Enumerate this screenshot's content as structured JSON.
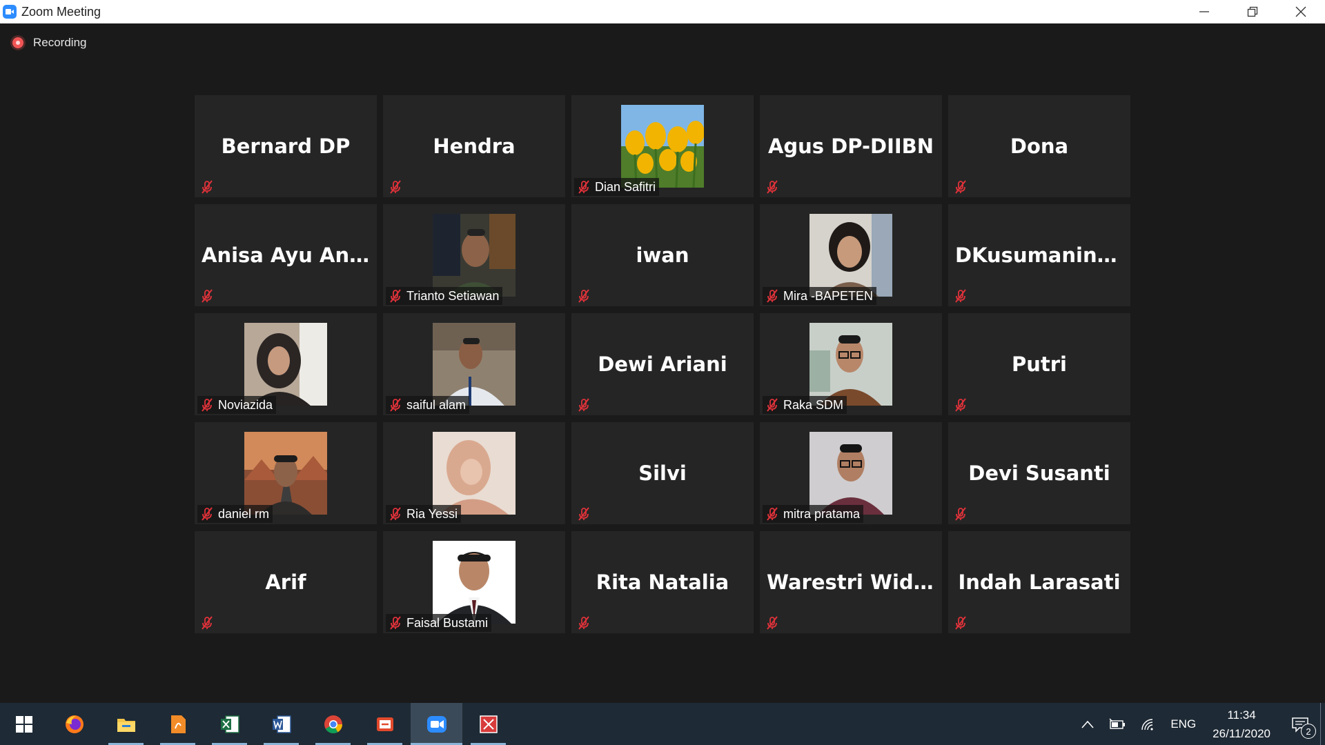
{
  "window": {
    "title": "Zoom Meeting"
  },
  "recording": {
    "label": "Recording"
  },
  "participants": [
    {
      "name": "Bernard DP",
      "video": false
    },
    {
      "name": "Hendra",
      "video": false
    },
    {
      "name": "Dian Safitri",
      "video": true,
      "photo": "tulip-flowers"
    },
    {
      "name": "Agus DP-DIIBN",
      "video": false
    },
    {
      "name": "Dona",
      "video": false
    },
    {
      "name": "Anisa Ayu Anin...",
      "video": false
    },
    {
      "name": "Trianto Setiawan",
      "video": true,
      "photo": "man-office"
    },
    {
      "name": "iwan",
      "video": false
    },
    {
      "name": "Mira -BAPETEN",
      "video": true,
      "photo": "woman-smile"
    },
    {
      "name": "DKusumaningt...",
      "video": false
    },
    {
      "name": "Noviazida",
      "video": true,
      "photo": "woman-hijab-dark"
    },
    {
      "name": "saiful alam",
      "video": true,
      "photo": "man-white-shirt"
    },
    {
      "name": "Dewi Ariani",
      "video": false
    },
    {
      "name": "Raka SDM",
      "video": true,
      "photo": "man-glasses-batik"
    },
    {
      "name": "Putri",
      "video": false
    },
    {
      "name": "daniel rm",
      "video": true,
      "photo": "man-desert-road"
    },
    {
      "name": "Ria Yessi",
      "video": true,
      "photo": "woman-hijab-pink"
    },
    {
      "name": "Silvi",
      "video": false
    },
    {
      "name": "mitra pratama",
      "video": true,
      "photo": "man-glasses-batik-2"
    },
    {
      "name": "Devi Susanti",
      "video": false
    },
    {
      "name": "Arif",
      "video": false
    },
    {
      "name": "Faisal Bustami",
      "video": true,
      "photo": "man-formal-portrait"
    },
    {
      "name": "Rita Natalia",
      "video": false
    },
    {
      "name": "Warestri Widiati",
      "video": false
    },
    {
      "name": "Indah Larasati",
      "video": false
    }
  ],
  "taskbar": {
    "apps": [
      "firefox-icon",
      "file-explorer-icon",
      "pdf-editor-icon",
      "excel-icon",
      "word-icon",
      "chrome-icon",
      "office-icon",
      "zoom-icon",
      "snipping-icon"
    ],
    "tray": {
      "language": "ENG",
      "time": "11:34",
      "date": "26/11/2020",
      "notifications": "2"
    }
  },
  "colors": {
    "background": "#1a1a1a",
    "tile": "#252525",
    "mute_red": "#e0323a",
    "recording_red": "#f25555",
    "taskbar": "#1e2a35"
  }
}
